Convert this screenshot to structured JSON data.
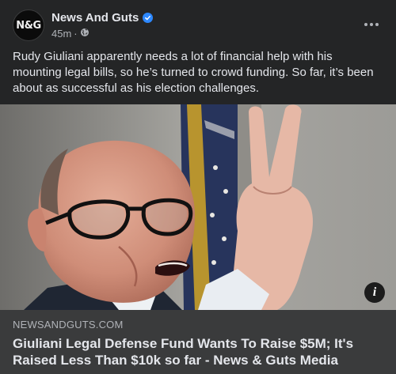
{
  "post": {
    "avatar_text": "N&G",
    "page_name": "News And Guts",
    "timestamp": "45m",
    "separator": "·",
    "privacy_icon": "globe-icon",
    "verified_icon": "verified-badge-icon",
    "more_icon": "more-options-icon",
    "text": "Rudy Giuliani apparently needs a lot of financial help with his mounting legal bills, so he’s turned to crowd funding.  So far, it’s been about as successful as his election challenges."
  },
  "link": {
    "domain": "NEWSANDGUTS.COM",
    "title": "Giuliani Legal Defense Fund Wants To Raise $5M; It's Raised Less Than $10k so far - News & Guts Media",
    "info_glyph": "i"
  },
  "colors": {
    "card_bg": "#242526",
    "link_bg": "#3a3b3c",
    "text_primary": "#e4e6eb",
    "text_secondary": "#b0b3b8",
    "verified_blue": "#2d88ff"
  }
}
